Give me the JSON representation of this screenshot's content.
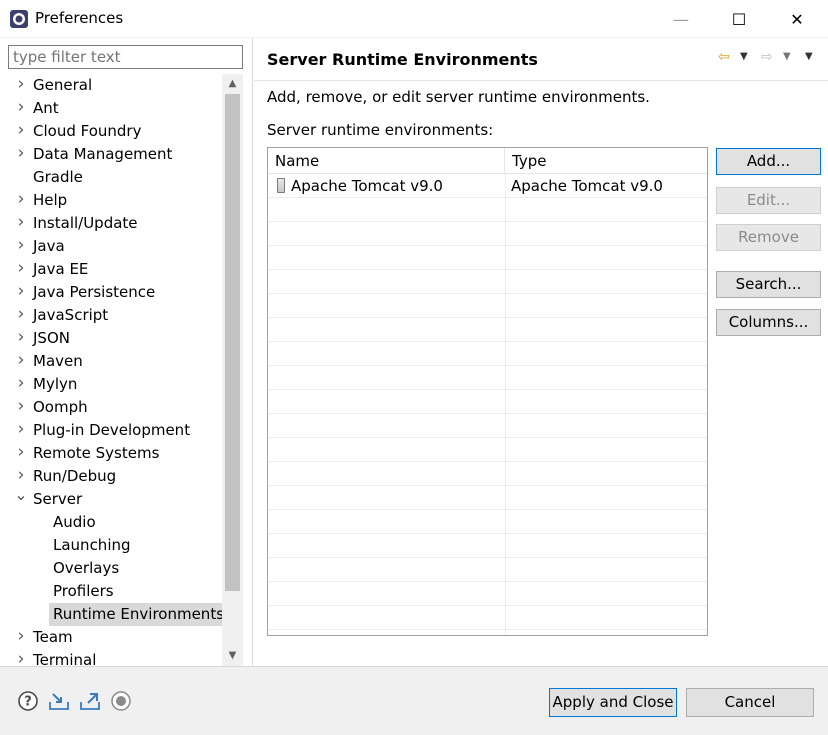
{
  "window": {
    "title": "Preferences",
    "minimize_glyph": "—",
    "maximize_glyph": "☐",
    "close_glyph": "✕"
  },
  "sidebar": {
    "filter_placeholder": "type filter text",
    "items": [
      {
        "label": "General",
        "expandable": true,
        "expanded": false,
        "level": 0
      },
      {
        "label": "Ant",
        "expandable": true,
        "expanded": false,
        "level": 0
      },
      {
        "label": "Cloud Foundry",
        "expandable": true,
        "expanded": false,
        "level": 0
      },
      {
        "label": "Data Management",
        "expandable": true,
        "expanded": false,
        "level": 0
      },
      {
        "label": "Gradle",
        "expandable": false,
        "expanded": false,
        "level": 0
      },
      {
        "label": "Help",
        "expandable": true,
        "expanded": false,
        "level": 0
      },
      {
        "label": "Install/Update",
        "expandable": true,
        "expanded": false,
        "level": 0
      },
      {
        "label": "Java",
        "expandable": true,
        "expanded": false,
        "level": 0
      },
      {
        "label": "Java EE",
        "expandable": true,
        "expanded": false,
        "level": 0
      },
      {
        "label": "Java Persistence",
        "expandable": true,
        "expanded": false,
        "level": 0
      },
      {
        "label": "JavaScript",
        "expandable": true,
        "expanded": false,
        "level": 0
      },
      {
        "label": "JSON",
        "expandable": true,
        "expanded": false,
        "level": 0
      },
      {
        "label": "Maven",
        "expandable": true,
        "expanded": false,
        "level": 0
      },
      {
        "label": "Mylyn",
        "expandable": true,
        "expanded": false,
        "level": 0
      },
      {
        "label": "Oomph",
        "expandable": true,
        "expanded": false,
        "level": 0
      },
      {
        "label": "Plug-in Development",
        "expandable": true,
        "expanded": false,
        "level": 0
      },
      {
        "label": "Remote Systems",
        "expandable": true,
        "expanded": false,
        "level": 0
      },
      {
        "label": "Run/Debug",
        "expandable": true,
        "expanded": false,
        "level": 0
      },
      {
        "label": "Server",
        "expandable": true,
        "expanded": true,
        "level": 0
      },
      {
        "label": "Audio",
        "expandable": false,
        "expanded": false,
        "level": 1
      },
      {
        "label": "Launching",
        "expandable": false,
        "expanded": false,
        "level": 1
      },
      {
        "label": "Overlays",
        "expandable": false,
        "expanded": false,
        "level": 1
      },
      {
        "label": "Profilers",
        "expandable": false,
        "expanded": false,
        "level": 1
      },
      {
        "label": "Runtime Environments",
        "expandable": false,
        "expanded": false,
        "level": 1,
        "selected": true
      },
      {
        "label": "Team",
        "expandable": true,
        "expanded": false,
        "level": 0
      },
      {
        "label": "Terminal",
        "expandable": true,
        "expanded": false,
        "level": 0
      }
    ],
    "scrollbar_level": 0.0
  },
  "page": {
    "title": "Server Runtime Environments",
    "description": "Add, remove, or edit server runtime environments.",
    "list_label": "Server runtime environments:",
    "table": {
      "columns": [
        "Name",
        "Type"
      ],
      "rows": [
        {
          "name": "Apache Tomcat v9.0",
          "type": "Apache Tomcat v9.0",
          "icon": "server-icon"
        }
      ]
    },
    "buttons": {
      "add": "Add...",
      "edit": "Edit...",
      "remove": "Remove",
      "search": "Search...",
      "columns": "Columns..."
    },
    "nav_icons": [
      "back-arrow-icon",
      "dropdown-icon",
      "forward-arrow-icon",
      "dropdown-icon",
      "view-menu-icon"
    ]
  },
  "footer": {
    "apply_close": "Apply and Close",
    "cancel": "Cancel",
    "icons": [
      "help-icon",
      "import-icon",
      "export-icon",
      "record-icon"
    ]
  },
  "colors": {
    "accent": "#0078d7",
    "back_arrow": "#d9a21b",
    "footer_bg": "#f0f0f0",
    "selection_bg": "#d9d9d9"
  }
}
